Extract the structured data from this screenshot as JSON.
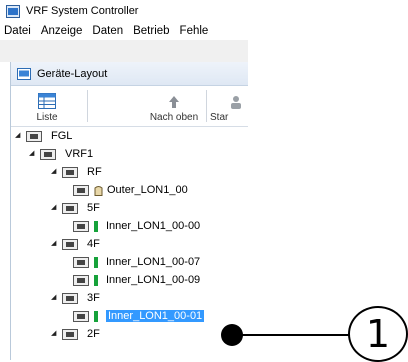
{
  "window": {
    "title": "VRF System Controller"
  },
  "menu": [
    "Datei",
    "Anzeige",
    "Daten",
    "Betrieb",
    "Fehle"
  ],
  "panel": {
    "title": "Geräte-Layout"
  },
  "toolbar": {
    "list_label": "Liste",
    "up_label": "Nach oben",
    "start_label": "Star"
  },
  "tree": {
    "fgl": "FGL",
    "vrf1": "VRF1",
    "rf": "RF",
    "outer": "Outer_LON1_00",
    "f5": "5F",
    "inner_5f": "Inner_LON1_00-00",
    "f4": "4F",
    "inner_4f_a": "Inner_LON1_00-07",
    "inner_4f_b": "Inner_LON1_00-09",
    "f3": "3F",
    "inner_3f": "Inner_LON1_00-01",
    "f2": "2F"
  },
  "callout": {
    "number": "1"
  },
  "colors": {
    "selection": "#3399ff",
    "device_status": "#16a23a"
  }
}
